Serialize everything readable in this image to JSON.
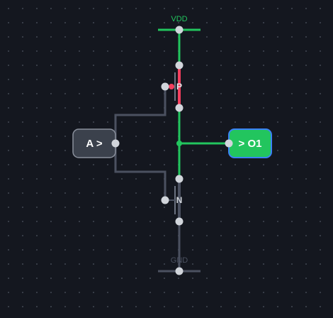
{
  "rails": {
    "vdd_label": "VDD",
    "gnd_label": "GND"
  },
  "transistors": {
    "pmos_label": "P",
    "nmos_label": "N"
  },
  "input": {
    "label": "A >"
  },
  "output": {
    "label": "> O1"
  },
  "colors": {
    "background": "#14171f",
    "grid_dot": "#3a3f4a",
    "wire_on": "#22c55e",
    "wire_off": "#4b5160",
    "pmos_active": "#f43f5e",
    "pin": "#d1d5db",
    "input_fill": "#3b414c",
    "output_fill": "#22c55e",
    "output_border": "#3b82f6"
  }
}
